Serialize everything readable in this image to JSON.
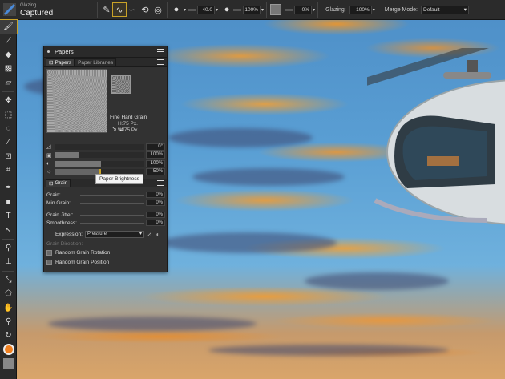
{
  "app": {
    "brush_category": "Glazing",
    "brush_variant": "Captured"
  },
  "toolbar": {
    "size_value": "40.0",
    "opacity_value": "100%",
    "grain_value": "0%",
    "glazing_label": "Glazing:",
    "glazing_value": "100%",
    "merge_mode_label": "Merge Mode:",
    "merge_mode_value": "Default"
  },
  "papers_panel": {
    "title": "Papers",
    "tabs": [
      {
        "label": "Papers",
        "active": true
      },
      {
        "label": "Paper Libraries",
        "active": false
      }
    ],
    "paper_name": "Fine Hard Grain",
    "paper_height": "H:75 Px.",
    "paper_width": "W:75 Px.",
    "controls": [
      {
        "icon": "angle-icon",
        "value": "0°",
        "level": 0
      },
      {
        "icon": "scale-icon",
        "value": "100%",
        "level": 0.27
      },
      {
        "icon": "contrast-icon",
        "value": "100%",
        "level": 0.52
      },
      {
        "icon": "brightness-icon",
        "value": "50%",
        "level": 0.5
      }
    ],
    "tooltip": "Paper Brightness"
  },
  "grain_panel": {
    "tab_label": "Grain",
    "params": [
      {
        "label": "Grain:",
        "value": "0%"
      },
      {
        "label": "Min Grain:",
        "value": "0%"
      },
      {
        "label": "Grain Jitter:",
        "value": "0%"
      },
      {
        "label": "Smoothness:",
        "value": "0%"
      }
    ],
    "expression_label": "Expression:",
    "expression_value": "Pressure",
    "grain_direction_label": "Grain Direction:",
    "checkboxes": [
      {
        "label": "Random Grain Rotation",
        "checked": false
      },
      {
        "label": "Random Grain Position",
        "checked": false
      }
    ]
  }
}
